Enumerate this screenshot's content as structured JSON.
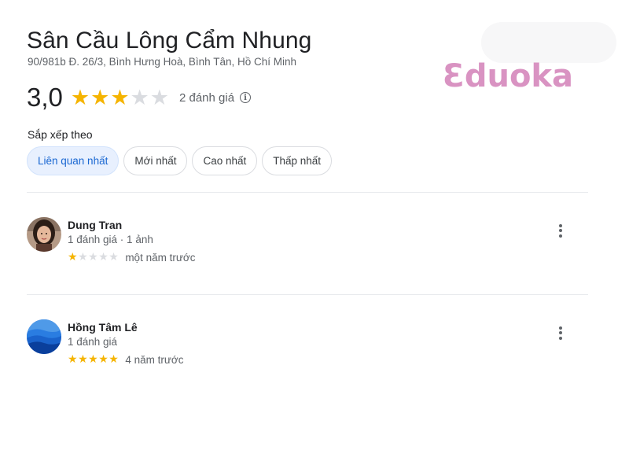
{
  "place": {
    "name": "Sân Cầu Lông Cẩm Nhung",
    "address": "90/981b Đ. 26/3, Bình Hưng Hoà, Bình Tân, Hồ Chí Minh",
    "rating": "3,0",
    "rating_value": 3,
    "max_stars": 5,
    "review_count": "2 đánh giá"
  },
  "watermark": {
    "text": "Ɛduoka",
    "color": "#d993c2"
  },
  "sort": {
    "label": "Sắp xếp theo",
    "options": [
      {
        "label": "Liên quan nhất",
        "active": true
      },
      {
        "label": "Mới nhất",
        "active": false
      },
      {
        "label": "Cao nhất",
        "active": false
      },
      {
        "label": "Thấp nhất",
        "active": false
      }
    ]
  },
  "reviews": [
    {
      "name": "Dung Tran",
      "meta": "1 đánh giá · 1 ảnh",
      "stars": 1,
      "time": "một năm trước",
      "avatar": "photo-avatar"
    },
    {
      "name": "Hồng Tâm Lê",
      "meta": "1 đánh giá",
      "stars": 5,
      "time": "4 năm trước",
      "avatar": "blue-waves-avatar"
    }
  ],
  "colors": {
    "star_on": "#f5b400",
    "star_off": "#dadce0",
    "active_chip_bg": "#e8f0fe",
    "active_chip_text": "#1967d2"
  }
}
